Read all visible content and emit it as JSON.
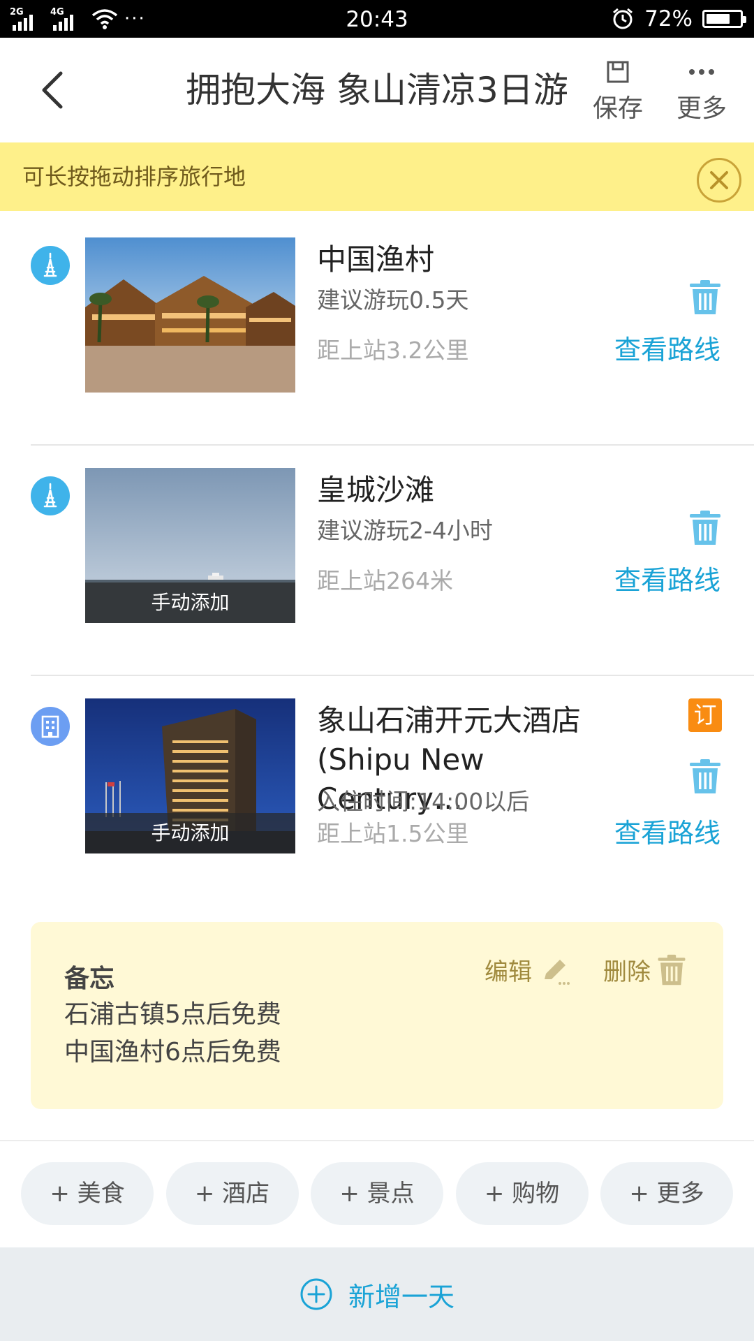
{
  "status_bar": {
    "net_left": "2G",
    "net_right": "4G",
    "dots": "···",
    "time": "20:43",
    "battery_pct": "72%",
    "battery_level": 0.72
  },
  "header": {
    "title": "拥抱大海 象山清凉3日游",
    "save_label": "保存",
    "more_label": "更多"
  },
  "tip": {
    "text": "可长按拖动排序旅行地"
  },
  "items": [
    {
      "type": "attraction",
      "name": "中国渔村",
      "sub": "建议游玩0.5天",
      "distance": "距上站3.2公里",
      "route_label": "查看路线"
    },
    {
      "type": "attraction",
      "name": "皇城沙滩",
      "sub": "建议游玩2-4小时",
      "distance": "距上站264米",
      "route_label": "查看路线",
      "tag": "手动添加"
    },
    {
      "type": "hotel",
      "name_line1": "象山石浦开元大酒店",
      "name_line2": "(Shipu New Century…",
      "sub": "入住时间:14:00以后",
      "distance": "距上站1.5公里",
      "route_label": "查看路线",
      "tag": "手动添加",
      "badge": "订"
    }
  ],
  "memo": {
    "title": "备忘",
    "lines": [
      "石浦古镇5点后免费",
      "中国渔村6点后免费"
    ],
    "edit_label": "编辑",
    "delete_label": "删除"
  },
  "quick_add": [
    "+ 美食",
    "+ 酒店",
    "+ 景点",
    "+ 购物",
    "+ 更多"
  ],
  "bottom": {
    "new_day_label": "新增一天"
  },
  "colors": {
    "accent": "#1aa3d6",
    "attraction_icon": "#3fb3ea",
    "hotel_icon": "#6c9ef2",
    "tip_bg": "#fef08a",
    "memo_bg": "#fff9d6",
    "badge": "#f98c12"
  }
}
